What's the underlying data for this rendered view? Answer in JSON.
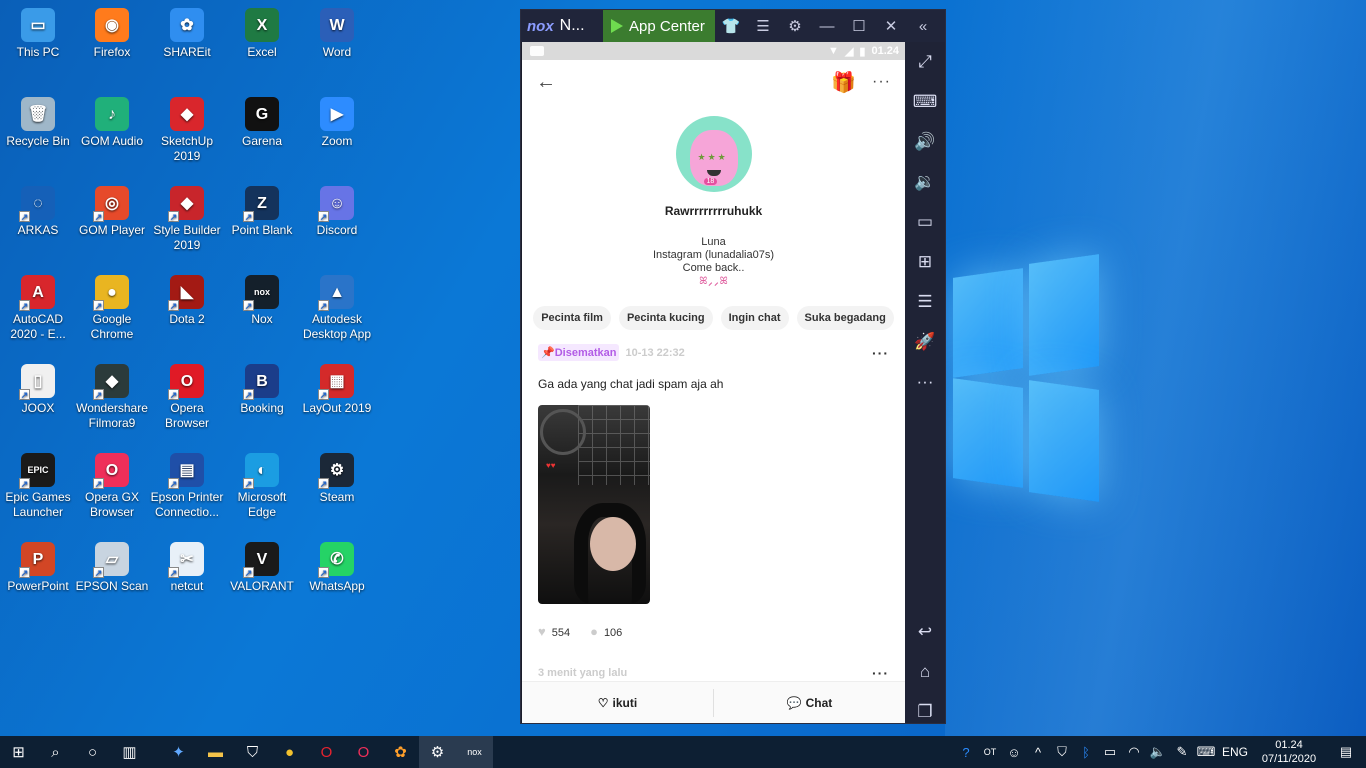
{
  "desktop_icons": [
    {
      "label": "This PC",
      "icon": "this-pc-icon",
      "color": "#3a9be8",
      "glyph": "▭"
    },
    {
      "label": "Firefox",
      "icon": "firefox-icon",
      "color": "#ff7b1c",
      "glyph": "◉"
    },
    {
      "label": "SHAREit",
      "icon": "shareit-icon",
      "color": "#2f8ef0",
      "glyph": "✿"
    },
    {
      "label": "Excel",
      "icon": "excel-icon",
      "color": "#1f7a43",
      "glyph": "X"
    },
    {
      "label": "Word",
      "icon": "word-icon",
      "color": "#2b5fb8",
      "glyph": "W"
    },
    {
      "label": "Recycle Bin",
      "icon": "recycle-bin-icon",
      "color": "#9fb7c9",
      "glyph": "🗑"
    },
    {
      "label": "GOM Audio",
      "icon": "gom-audio-icon",
      "color": "#20b07a",
      "glyph": "♪"
    },
    {
      "label": "SketchUp 2019",
      "icon": "sketchup-icon",
      "color": "#d9262c",
      "glyph": "◆"
    },
    {
      "label": "Garena",
      "icon": "garena-icon",
      "color": "#111111",
      "glyph": "G"
    },
    {
      "label": "Zoom",
      "icon": "zoom-icon",
      "color": "#2d8cff",
      "glyph": "▶"
    },
    {
      "label": "ARKAS",
      "icon": "arkas-icon",
      "color": "#1560b8",
      "glyph": "◌"
    },
    {
      "label": "GOM Player",
      "icon": "gom-player-icon",
      "color": "#e64a2a",
      "glyph": "◎"
    },
    {
      "label": "Style Builder 2019",
      "icon": "style-builder-icon",
      "color": "#c8252b",
      "glyph": "◆"
    },
    {
      "label": "Point Blank",
      "icon": "point-blank-icon",
      "color": "#14335c",
      "glyph": "Z"
    },
    {
      "label": "Discord",
      "icon": "discord-icon",
      "color": "#6774e6",
      "glyph": "☺"
    },
    {
      "label": "AutoCAD 2020 - E...",
      "icon": "autocad-icon",
      "color": "#d8262c",
      "glyph": "A"
    },
    {
      "label": "Google Chrome",
      "icon": "chrome-icon",
      "color": "#e9b521",
      "glyph": "●"
    },
    {
      "label": "Dota 2",
      "icon": "dota2-icon",
      "color": "#a31a14",
      "glyph": "◣"
    },
    {
      "label": "Nox",
      "icon": "nox-icon",
      "color": "#14202b",
      "glyph": "nox"
    },
    {
      "label": "Autodesk Desktop App",
      "icon": "autodesk-icon",
      "color": "#2a74c9",
      "glyph": "▲"
    },
    {
      "label": "JOOX",
      "icon": "joox-icon",
      "color": "#f0f0f0",
      "glyph": "▯"
    },
    {
      "label": "Wondershare Filmora9",
      "icon": "filmora-icon",
      "color": "#2b3b3b",
      "glyph": "◆"
    },
    {
      "label": "Opera Browser",
      "icon": "opera-icon",
      "color": "#e01a26",
      "glyph": "O"
    },
    {
      "label": "Booking",
      "icon": "booking-icon",
      "color": "#1b3d8a",
      "glyph": "B"
    },
    {
      "label": "LayOut 2019",
      "icon": "layout-icon",
      "color": "#d42a2a",
      "glyph": "▦"
    },
    {
      "label": "Epic Games Launcher",
      "icon": "epic-games-icon",
      "color": "#1a1a1a",
      "glyph": "EPIC"
    },
    {
      "label": "Opera GX Browser",
      "icon": "opera-gx-icon",
      "color": "#ef2f5a",
      "glyph": "O"
    },
    {
      "label": "Epson Printer Connectio...",
      "icon": "epson-printer-icon",
      "color": "#1f4fa8",
      "glyph": "▤"
    },
    {
      "label": "Microsoft Edge",
      "icon": "edge-icon",
      "color": "#1b9de2",
      "glyph": "◐"
    },
    {
      "label": "Steam",
      "icon": "steam-icon",
      "color": "#1b2838",
      "glyph": "⚙"
    },
    {
      "label": "PowerPoint",
      "icon": "powerpoint-icon",
      "color": "#d24625",
      "glyph": "P"
    },
    {
      "label": "EPSON Scan",
      "icon": "epson-scan-icon",
      "color": "#c8d4e0",
      "glyph": "▱"
    },
    {
      "label": "netcut",
      "icon": "netcut-icon",
      "color": "#e8f0f8",
      "glyph": "✂"
    },
    {
      "label": "VALORANT",
      "icon": "valorant-icon",
      "color": "#1a1a1a",
      "glyph": "V"
    },
    {
      "label": "WhatsApp",
      "icon": "whatsapp-icon",
      "color": "#25d366",
      "glyph": "✆"
    }
  ],
  "nox": {
    "title": "N...",
    "app_center": "App Center",
    "status_time": "01.24"
  },
  "profile": {
    "username": "Rawrrrrrrrruhukk",
    "avatar_badge": "18",
    "bio_lines": [
      "Luna",
      "Instagram (lunadalia07s)",
      "Come back.."
    ],
    "bio_deco": "ꕤ⸝⸝ꕤ",
    "tags": [
      "Pecinta film",
      "Pecinta kucing",
      "Ingin chat",
      "Suka begadang"
    ]
  },
  "post": {
    "pinned_label": "Disematkan",
    "timestamp": "10-13 22:32",
    "text": "Ga ada yang chat jadi spam aja ah",
    "likes": "554",
    "comments": "106"
  },
  "post2": {
    "timestamp": "3 menit yang lalu"
  },
  "bottom_bar": {
    "follow_label": "ikuti",
    "chat_label": "Chat"
  },
  "taskbar": {
    "language": "ENG",
    "time": "01.24",
    "date": "07/11/2020"
  },
  "colors": {
    "desktop_bg": "#0b78d6",
    "nox_chrome": "#20253a",
    "app_center_green": "#3b7c2f",
    "pin_purple": "#b25ce6",
    "taskbar_bg": "#0d1f33"
  }
}
